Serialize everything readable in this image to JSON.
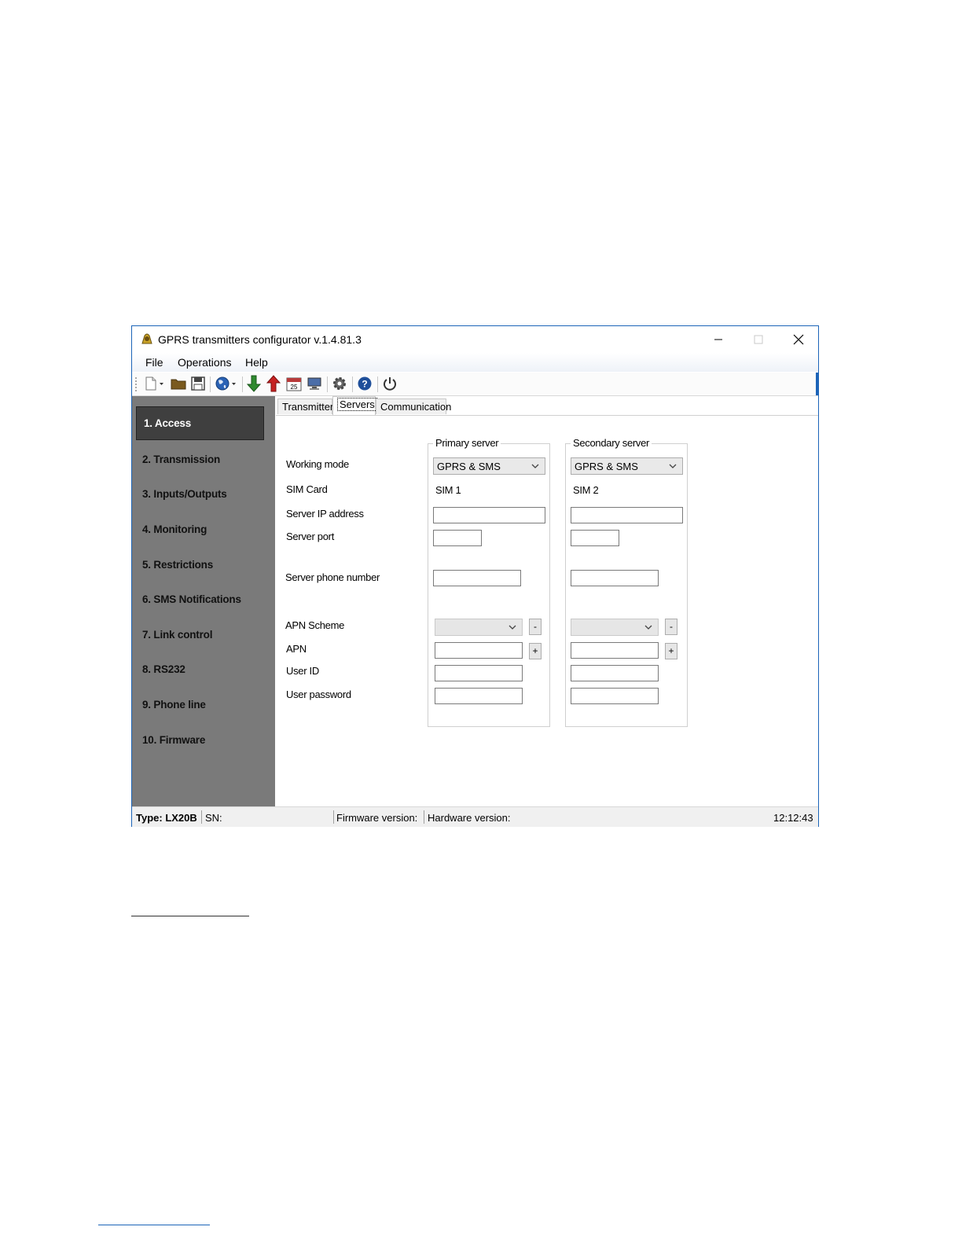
{
  "window": {
    "title": "GPRS transmitters configurator v.1.4.81.3"
  },
  "menu": [
    "File",
    "Operations",
    "Help"
  ],
  "toolbar": {
    "icons": [
      "new-file-icon",
      "open-folder-icon",
      "save-icon",
      "globe-icon",
      "download-arrow-icon",
      "upload-arrow-icon",
      "calendar-icon",
      "monitor-icon",
      "gear-icon",
      "help-icon",
      "power-icon"
    ],
    "calendar_day": "25"
  },
  "sidebar": {
    "items": [
      {
        "label": "1. Access"
      },
      {
        "label": "2. Transmission"
      },
      {
        "label": "3. Inputs/Outputs"
      },
      {
        "label": "4. Monitoring"
      },
      {
        "label": "5. Restrictions"
      },
      {
        "label": "6. SMS Notifications"
      },
      {
        "label": "7. Link control"
      },
      {
        "label": "8. RS232"
      },
      {
        "label": "9. Phone line"
      },
      {
        "label": "10. Firmware"
      }
    ],
    "active_index": 0
  },
  "tabs": [
    {
      "label": "Transmitter"
    },
    {
      "label": "Servers"
    },
    {
      "label": "Communication"
    }
  ],
  "form": {
    "labels": {
      "working_mode": "Working mode",
      "sim_card": "SIM Card",
      "server_ip": "Server IP address",
      "server_port": "Server port",
      "server_phone": "Server phone number",
      "apn_scheme": "APN Scheme",
      "apn": "APN",
      "user_id": "User ID",
      "user_password": "User password"
    },
    "primary": {
      "title": "Primary server",
      "working_mode": "GPRS & SMS",
      "sim": "SIM 1",
      "server_ip": "",
      "server_port": "",
      "server_phone": "",
      "apn_scheme": "",
      "apn": "",
      "user_id": "",
      "user_password": ""
    },
    "secondary": {
      "title": "Secondary server",
      "working_mode": "GPRS & SMS",
      "sim": "SIM 2",
      "server_ip": "",
      "server_port": "",
      "server_phone": "",
      "apn_scheme": "",
      "apn": "",
      "user_id": "",
      "user_password": ""
    },
    "minus_label": "-",
    "plus_label": "+"
  },
  "status": {
    "type": "Type: LX20B",
    "sn": "SN:",
    "firmware": "Firmware version:",
    "hardware": "Hardware version:",
    "time": "12:12:43"
  }
}
